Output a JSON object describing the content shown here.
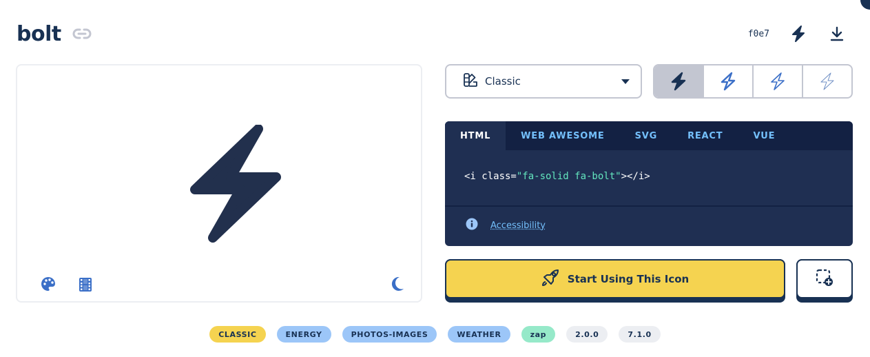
{
  "header": {
    "title": "bolt",
    "unicode": "f0e7",
    "icons": [
      "link-icon",
      "bolt-icon",
      "download-icon"
    ]
  },
  "preview": {
    "tools": [
      "palette-icon",
      "film-icon",
      "moon-icon"
    ]
  },
  "style_select": {
    "selected": "Classic",
    "icon": "swatchbook-icon"
  },
  "variants": [
    {
      "name": "solid",
      "active": true
    },
    {
      "name": "regular",
      "active": false
    },
    {
      "name": "light",
      "active": false
    },
    {
      "name": "thin",
      "active": false
    }
  ],
  "code": {
    "tabs": [
      "HTML",
      "WEB AWESOME",
      "SVG",
      "REACT",
      "VUE"
    ],
    "active_tab": "HTML",
    "prefix": "<i class=",
    "value": "\"fa-solid fa-bolt\"",
    "suffix": "></i>",
    "accessibility_link": "Accessibility"
  },
  "start_button": "Start Using This Icon",
  "tags": [
    {
      "label": "CLASSIC",
      "color": "yellow"
    },
    {
      "label": "ENERGY",
      "color": "blue"
    },
    {
      "label": "PHOTOS-IMAGES",
      "color": "blue"
    },
    {
      "label": "WEATHER",
      "color": "blue"
    },
    {
      "label": "zap",
      "color": "green"
    },
    {
      "label": "2.0.0",
      "color": "gray"
    },
    {
      "label": "7.1.0",
      "color": "gray"
    }
  ],
  "colors": {
    "navy": "#183153",
    "yellow": "#f5d350",
    "code_bg": "#1f2f52",
    "accent_blue": "#74c0fc",
    "icon_blue": "#3b6fc7"
  }
}
